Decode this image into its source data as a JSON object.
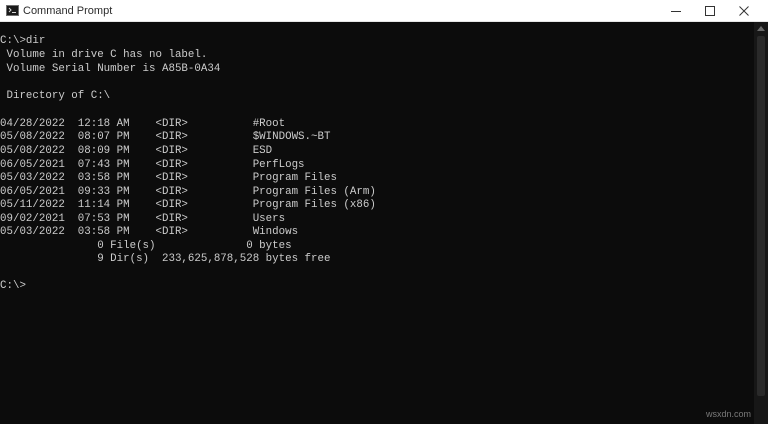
{
  "window": {
    "title": "Command Prompt"
  },
  "terminal": {
    "lines": [
      "C:\\>dir",
      " Volume in drive C has no label.",
      " Volume Serial Number is A85B-0A34",
      "",
      " Directory of C:\\",
      "",
      "04/28/2022  12:18 AM    <DIR>          #Root",
      "05/08/2022  08:07 PM    <DIR>          $WINDOWS.~BT",
      "05/08/2022  08:09 PM    <DIR>          ESD",
      "06/05/2021  07:43 PM    <DIR>          PerfLogs",
      "05/03/2022  03:58 PM    <DIR>          Program Files",
      "06/05/2021  09:33 PM    <DIR>          Program Files (Arm)",
      "05/11/2022  11:14 PM    <DIR>          Program Files (x86)",
      "09/02/2021  07:53 PM    <DIR>          Users",
      "05/03/2022  03:58 PM    <DIR>          Windows",
      "               0 File(s)              0 bytes",
      "               9 Dir(s)  233,625,878,528 bytes free",
      "",
      "C:\\>"
    ]
  },
  "watermark": "wsxdn.com",
  "colors": {
    "terminal_bg": "#0c0c0c",
    "terminal_text": "#cccccc",
    "titlebar_bg": "#ffffff"
  }
}
